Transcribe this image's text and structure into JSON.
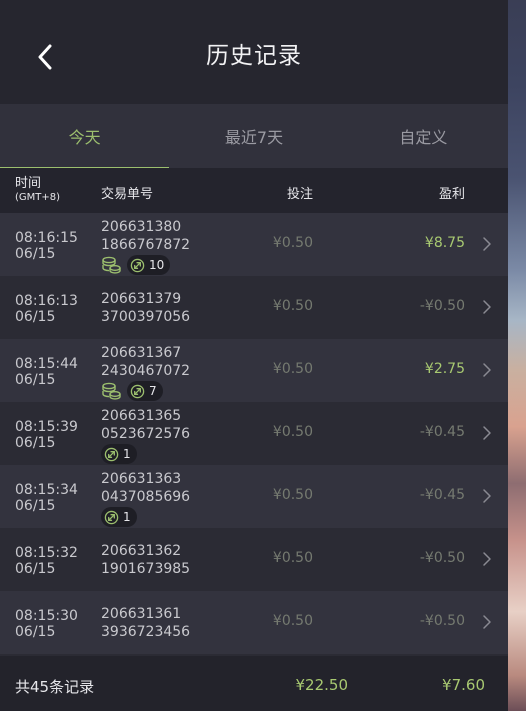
{
  "header": {
    "title": "历史记录"
  },
  "tabs": [
    {
      "label": "今天",
      "active": true
    },
    {
      "label": "最近7天",
      "active": false
    },
    {
      "label": "自定义",
      "active": false
    }
  ],
  "columns": {
    "time": "时间",
    "time_zone": "(GMT+8)",
    "order": "交易单号",
    "bet": "投注",
    "profit": "盈利"
  },
  "rows": [
    {
      "time": "08:16:15",
      "date": "06/15",
      "order1": "206631380",
      "order2": "1866767872",
      "coin": true,
      "pill": "10",
      "bet": "¥0.50",
      "profit": "¥8.75",
      "win": true
    },
    {
      "time": "08:16:13",
      "date": "06/15",
      "order1": "206631379",
      "order2": "3700397056",
      "coin": false,
      "pill": "",
      "bet": "¥0.50",
      "profit": "-¥0.50",
      "win": false
    },
    {
      "time": "08:15:44",
      "date": "06/15",
      "order1": "206631367",
      "order2": "2430467072",
      "coin": true,
      "pill": "7",
      "bet": "¥0.50",
      "profit": "¥2.75",
      "win": true
    },
    {
      "time": "08:15:39",
      "date": "06/15",
      "order1": "206631365",
      "order2": "0523672576",
      "coin": false,
      "pill": "1",
      "bet": "¥0.50",
      "profit": "-¥0.45",
      "win": false
    },
    {
      "time": "08:15:34",
      "date": "06/15",
      "order1": "206631363",
      "order2": "0437085696",
      "coin": false,
      "pill": "1",
      "bet": "¥0.50",
      "profit": "-¥0.45",
      "win": false
    },
    {
      "time": "08:15:32",
      "date": "06/15",
      "order1": "206631362",
      "order2": "1901673985",
      "coin": false,
      "pill": "",
      "bet": "¥0.50",
      "profit": "-¥0.50",
      "win": false
    },
    {
      "time": "08:15:30",
      "date": "06/15",
      "order1": "206631361",
      "order2": "3936723456",
      "coin": false,
      "pill": "",
      "bet": "¥0.50",
      "profit": "-¥0.50",
      "win": false
    }
  ],
  "footer": {
    "total_label": "共45条记录",
    "total_bet": "¥22.50",
    "total_profit": "¥7.60"
  },
  "colors": {
    "accent": "#9cbf6e",
    "win": "#a8c971",
    "muted": "#757a70",
    "background": "#2b2b34"
  },
  "icons": {
    "back": "chevron-left-icon",
    "row_arrow": "chevron-right-icon",
    "coin": "coin-stack-icon",
    "pill": "spin-arrow-icon"
  }
}
